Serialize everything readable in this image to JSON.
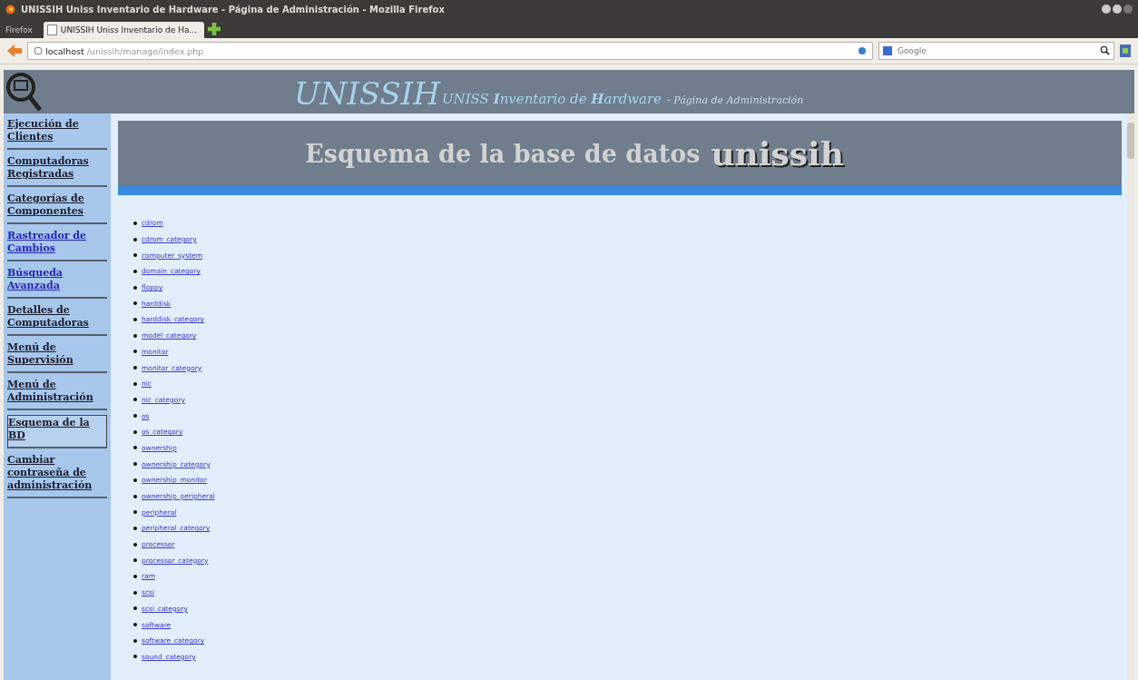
{
  "window": {
    "title": "UNISSIH Uniss Inventario de Hardware - Página de Administración - Mozilla Firefox"
  },
  "browser": {
    "menu_button": "Firefox",
    "tabs": [
      {
        "label": "UNISSIH Uniss Inventario de Ha...",
        "selected": true
      }
    ],
    "url_host": "localhost",
    "url_path": "/unissih/manage/index.php",
    "search_placeholder": "Google"
  },
  "header": {
    "logo_text": "UNISSIH",
    "subtitle": "UNISS **I**nventario de **H**ardware",
    "subtitle_tail": "- Página de Administración"
  },
  "sidebar": {
    "items": [
      {
        "label": "Ejecución de Clientes",
        "visited": true,
        "selected": false
      },
      {
        "label": "Computadoras Registradas",
        "visited": true,
        "selected": false
      },
      {
        "label": "Categorías de Componentes",
        "visited": true,
        "selected": false
      },
      {
        "label": "Rastreador de Cambios",
        "visited": false,
        "selected": false
      },
      {
        "label": "Búsqueda Avanzada",
        "visited": false,
        "selected": false
      },
      {
        "label": "Detalles de Computadoras",
        "visited": true,
        "selected": false
      },
      {
        "label": "Menú de Supervisión",
        "visited": true,
        "selected": false
      },
      {
        "label": "Menú de Administración",
        "visited": true,
        "selected": false
      },
      {
        "label": "Esquema de la BD",
        "visited": true,
        "selected": true
      },
      {
        "label": "Cambiar contraseña de administración",
        "visited": true,
        "selected": false
      }
    ]
  },
  "banner": {
    "title": "Esquema de la base de datos",
    "db_name": "unissih"
  },
  "tables": [
    "cdrom",
    "cdrom_category",
    "computer_system",
    "domain_category",
    "floppy",
    "harddisk",
    "harddisk_category",
    "model_category",
    "monitor",
    "monitor_category",
    "nic",
    "nic_category",
    "os",
    "os_category",
    "ownership",
    "ownership_category",
    "ownership_monitor",
    "ownership_peripheral",
    "peripheral",
    "peripheral_category",
    "processor",
    "processor_category",
    "ram",
    "scsi",
    "scsi_category",
    "software",
    "software_category",
    "sound_category"
  ]
}
